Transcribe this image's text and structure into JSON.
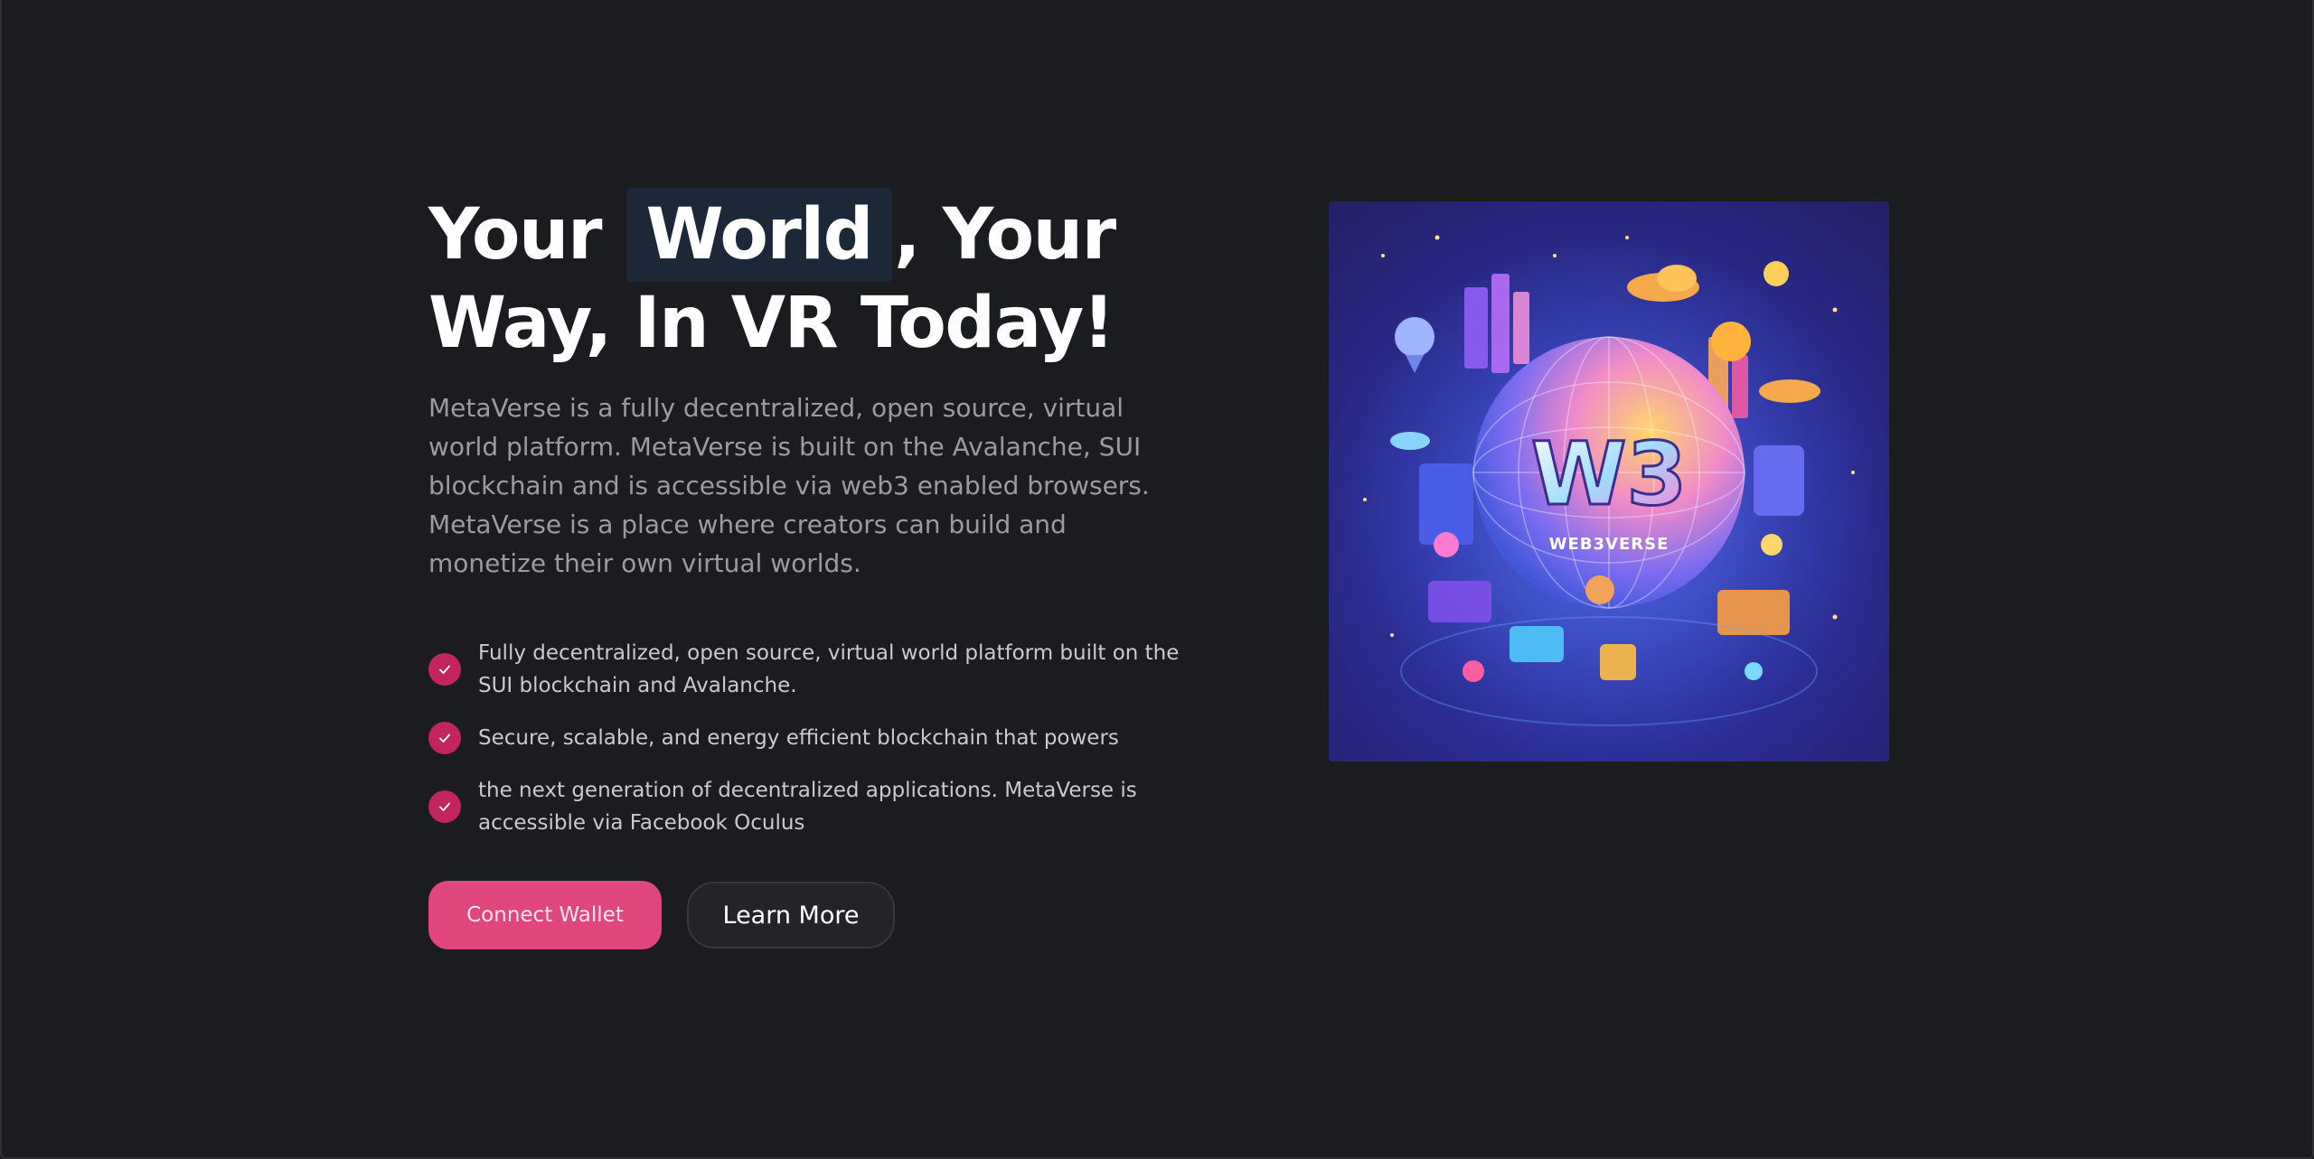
{
  "hero": {
    "headline_before": "Your ",
    "headline_highlight": "World",
    "headline_after": ", Your Way, In VR Today!",
    "description": "MetaVerse is a fully decentralized, open source, virtual world platform. MetaVerse is built on the Avalanche, SUI blockchain and is accessible via web3 enabled browsers. MetaVerse is a place where creators can build and monetize their own virtual worlds.",
    "features": [
      "Fully decentralized, open source, virtual world platform built on the SUI blockchain and Avalanche.",
      "Secure, scalable, and energy efficient blockchain that powers",
      "the next generation of decentralized applications. MetaVerse is accessible via Facebook Oculus"
    ],
    "primary_button": "Connect Wallet",
    "secondary_button": "Learn More",
    "image": {
      "icon": "web3verse-illustration",
      "logo_text": "W3",
      "caption": "WEB3VERSE"
    }
  },
  "colors": {
    "background": "#1b1c20",
    "accent": "#e0457c",
    "check": "#c2245e",
    "highlight_bg": "#1c2838"
  }
}
